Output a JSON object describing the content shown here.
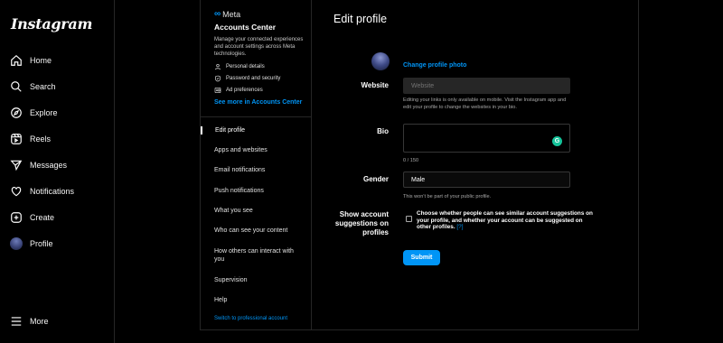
{
  "nav": {
    "logo": "Instagram",
    "items": [
      {
        "label": "Home",
        "icon": "home-icon"
      },
      {
        "label": "Search",
        "icon": "search-icon"
      },
      {
        "label": "Explore",
        "icon": "compass-icon"
      },
      {
        "label": "Reels",
        "icon": "reels-icon"
      },
      {
        "label": "Messages",
        "icon": "messages-icon"
      },
      {
        "label": "Notifications",
        "icon": "heart-icon"
      },
      {
        "label": "Create",
        "icon": "plus-square-icon"
      },
      {
        "label": "Profile",
        "icon": "avatar"
      }
    ],
    "more": "More"
  },
  "accounts_center": {
    "brand": "Meta",
    "title": "Accounts Center",
    "description": "Manage your connected experiences and account settings across Meta technologies.",
    "links": [
      {
        "label": "Personal details",
        "icon": "person-icon"
      },
      {
        "label": "Password and security",
        "icon": "shield-icon"
      },
      {
        "label": "Ad preferences",
        "icon": "ad-icon"
      }
    ],
    "see_more": "See more in Accounts Center"
  },
  "settings_menu": {
    "items": [
      "Edit profile",
      "Apps and websites",
      "Email notifications",
      "Push notifications",
      "What you see",
      "Who can see your content",
      "How others can interact with you",
      "Supervision",
      "Help"
    ],
    "active_index": 0,
    "switch_link": "Switch to professional account"
  },
  "edit_profile": {
    "title": "Edit profile",
    "username": "",
    "change_photo": "Change profile photo",
    "website_label": "Website",
    "website_placeholder": "Website",
    "website_hint": "Editing your links is only available on mobile. Visit the Instagram app and edit your profile to change the websites in your bio.",
    "bio_label": "Bio",
    "bio_value": "",
    "bio_count": "0 / 150",
    "gender_label": "Gender",
    "gender_value": "Male",
    "gender_hint": "This won't be part of your public profile.",
    "suggestions_label": "Show account suggestions on profiles",
    "suggestions_text": "Choose whether people can see similar account suggestions on your profile, and whether your account can be suggested on other profiles.",
    "suggestions_help": "[?]",
    "submit": "Submit"
  },
  "colors": {
    "accent": "#0095f6",
    "background": "#000000",
    "border": "#262626"
  }
}
